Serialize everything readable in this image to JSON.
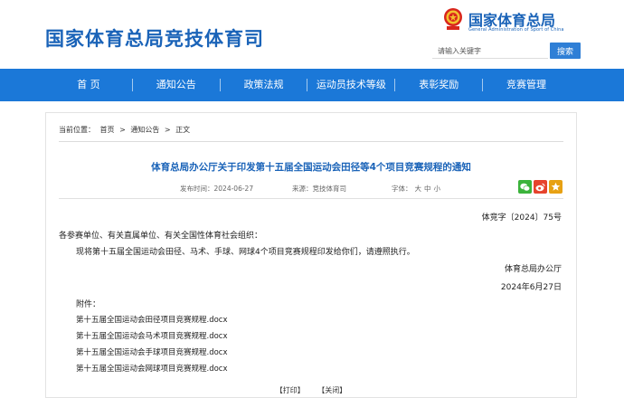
{
  "header": {
    "site_title": "国家体育总局竞技体育司",
    "brand_cn": "国家体育总局",
    "brand_en": "General Administration of Sport of China",
    "search_placeholder": "请输入关键字",
    "search_button": "搜索"
  },
  "nav": {
    "items": [
      {
        "label": "首 页"
      },
      {
        "label": "通知公告"
      },
      {
        "label": "政策法规"
      },
      {
        "label": "运动员技术等级"
      },
      {
        "label": "表彰奖励"
      },
      {
        "label": "竞赛管理"
      }
    ]
  },
  "breadcrumb": {
    "prefix": "当前位置：",
    "items": [
      "首页",
      "通知公告",
      "正文"
    ],
    "separator": ">"
  },
  "article": {
    "title": "体育总局办公厅关于印发第十五届全国运动会田径等4个项目竞赛规程的通知",
    "published": "发布时间：2024-06-27",
    "source": "来源：竞技体育司",
    "font_label": "字体：",
    "font_sizes": [
      "大",
      "中",
      "小"
    ],
    "doc_number": "体竞字〔2024〕75号",
    "salutation": "各参赛单位、有关直属单位、有关全国性体育社会组织：",
    "body": "现将第十五届全国运动会田径、马术、手球、网球4个项目竞赛规程印发给你们，请遵照执行。",
    "signer": "体育总局办公厅",
    "date": "2024年6月27日",
    "attachments_label": "附件：",
    "attachments": [
      "第十五届全国运动会田径项目竞赛规程.docx",
      "第十五届全国运动会马术项目竞赛规程.docx",
      "第十五届全国运动会手球项目竞赛规程.docx",
      "第十五届全国运动会网球项目竞赛规程.docx"
    ]
  },
  "share": {
    "icons": [
      "wechat-icon",
      "weibo-icon",
      "favorite-star-icon"
    ],
    "colors": {
      "wechat": "#3bb33b",
      "weibo": "#e6432d",
      "favorite": "#e7a113"
    }
  },
  "actions": {
    "print": "【打印】",
    "close": "【关闭】"
  },
  "colors": {
    "accent": "#1a63b8",
    "nav_background": "#1b78d8",
    "search_button": "#2f7fd6"
  }
}
